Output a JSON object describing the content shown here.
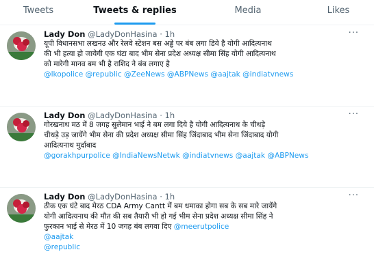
{
  "tabs": [
    "Tweets",
    "Tweets & replies",
    "Media",
    "Likes"
  ],
  "colors": {
    "accent": "#1d9bf0",
    "text": "#0f1419",
    "muted": "#536471"
  },
  "more_icon": "···",
  "tweets": [
    {
      "name": "Lady Don",
      "handle": "@LadyDonHasina",
      "time": "· 1h",
      "lines": [
        "यूपी विधानसभा लखनउ और रेलवे स्टेशन बस अड्डे पर बंब लगा डिये है योगी आदित्यनाथ",
        "की भी हत्या हो जायेगी एक घंटा बाद भीम सेना प्रदेश अध्यक्ष सीमा सिंह योगी आदित्यनाथ",
        "को मारेगी मानव बम भी है राशिद ने बंब लगाए है"
      ],
      "links": [
        "@lkopolice @republic @ZeeNews @ABPNews @aajtak @indiatvnews"
      ]
    },
    {
      "name": "Lady Don",
      "handle": "@LadyDonHasina",
      "time": "· 1h",
      "lines": [
        "गोरखनाथ मठ में 8 जगह सुलेमान भाई ने बम लगा दिये है योगी आदित्यनाथ के चीथड़े",
        "चीथड़े उड़ जायेंगे भीम सेना की प्रदेश अध्यक्ष सीमा सिंह जिंदाबाद भीम सेना जिंदाबाद योगी",
        "आदित्यनाथ मुर्दाबाद"
      ],
      "links": [
        "@gorakhpurpolice @IndiaNewsNetwk @indiatvnews @aajtak @ABPNews"
      ]
    },
    {
      "name": "Lady Don",
      "handle": "@LadyDonHasina",
      "time": "· 1h",
      "lines": [
        "ठीक एक घंटे बाद मेरठ CDA Army Cantt में बम धमाका होगा सब के सब मारे जायेंगे",
        "योगी आदित्यनाथ की मौत की सब तैयारी भी हो गई भीम सेना प्रदेश अध्यक्ष सीमा सिंह ने"
      ],
      "last_line_text": "फुरकान भाई से मेरठ में 10 जगह बंब लगवा दिए ",
      "last_line_link": "@meerutpolice",
      "links": [
        "@aajtak",
        "@republic"
      ]
    }
  ]
}
